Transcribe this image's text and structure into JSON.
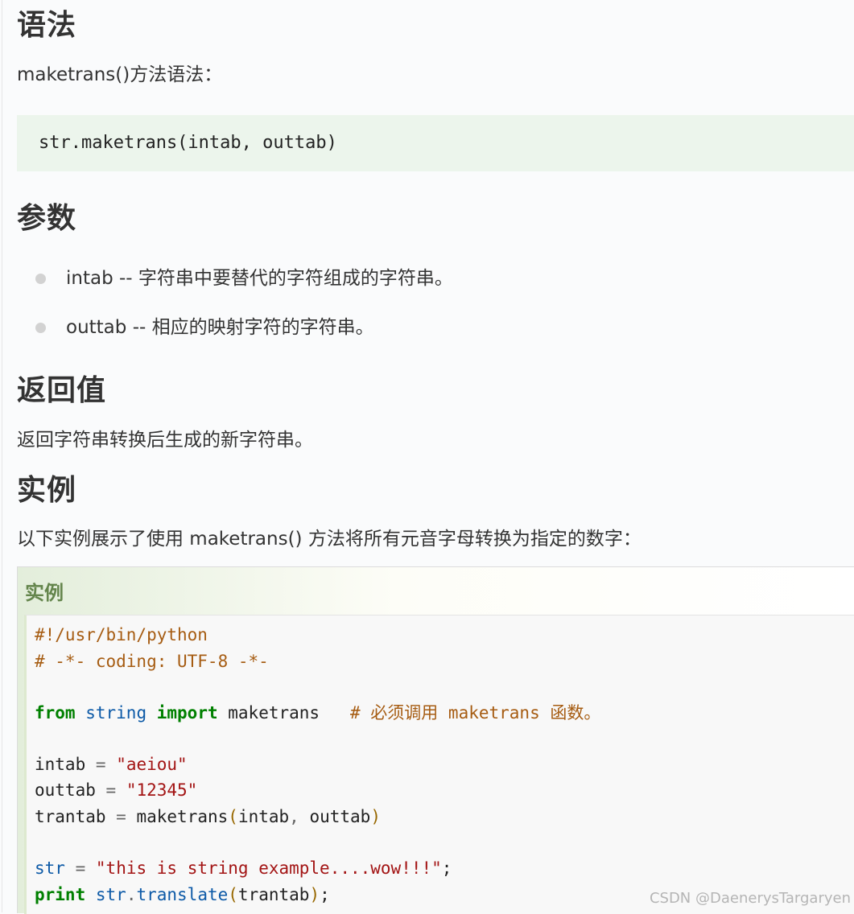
{
  "sections": {
    "syntax": {
      "heading": "语法",
      "intro": "maketrans()方法语法：",
      "code": "str.maketrans(intab, outtab)"
    },
    "params": {
      "heading": "参数",
      "items": [
        "intab -- 字符串中要替代的字符组成的字符串。",
        "outtab -- 相应的映射字符的字符串。"
      ]
    },
    "returns": {
      "heading": "返回值",
      "text": "返回字符串转换后生成的新字符串。"
    },
    "example": {
      "heading": "实例",
      "intro": "以下实例展示了使用 maketrans() 方法将所有元音字母转换为指定的数字：",
      "box_title": "实例",
      "code": {
        "line1": "#!/usr/bin/python",
        "line2": "# -*- coding: UTF-8 -*-",
        "line3": {
          "kw_from": "from",
          "mod": "string",
          "kw_import": "import",
          "name": "maketrans",
          "comment": "# 必须调用 maketrans 函数。"
        },
        "line4": {
          "var": "intab",
          "op": "=",
          "str": "\"aeiou\""
        },
        "line5": {
          "var": "outtab",
          "op": "=",
          "str": "\"12345\""
        },
        "line6": {
          "var": "trantab",
          "op": "=",
          "fn": "maketrans",
          "lp": "(",
          "arg1": "intab",
          "comma": ",",
          "arg2": "outtab",
          "rp": ")"
        },
        "line7": {
          "var": "str",
          "op": "=",
          "str": "\"this is string example....wow!!!\"",
          "semi": ";"
        },
        "line8": {
          "kw": "print",
          "obj": "str",
          "dot": ".",
          "method": "translate",
          "lp": "(",
          "arg": "trantab",
          "rp": ")",
          "semi": ";"
        }
      }
    }
  },
  "watermark": "CSDN @DaenerysTargaryen"
}
